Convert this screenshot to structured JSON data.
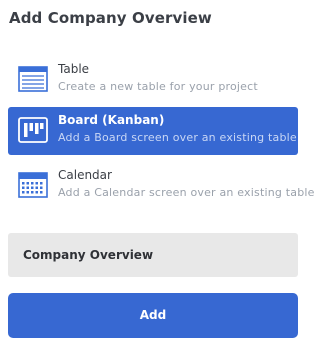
{
  "dialog": {
    "title": "Add Company Overview"
  },
  "options": [
    {
      "title": "Table",
      "description": "Create a new table for your project",
      "icon": "table-icon",
      "selected": false
    },
    {
      "title": "Board (Kanban)",
      "description": "Add a Board screen over an existing table",
      "icon": "kanban-board-icon",
      "selected": true
    },
    {
      "title": "Calendar",
      "description": "Add a Calendar screen over an existing table",
      "icon": "calendar-icon",
      "selected": false
    }
  ],
  "name_field": {
    "value": "Company Overview"
  },
  "add_button": {
    "label": "Add"
  },
  "colors": {
    "accent": "#3768d2",
    "icon_blue": "#3a6fd8",
    "title_text": "#3b3f46",
    "description_text": "#9aa1ab",
    "field_background": "#e8e8e8"
  }
}
